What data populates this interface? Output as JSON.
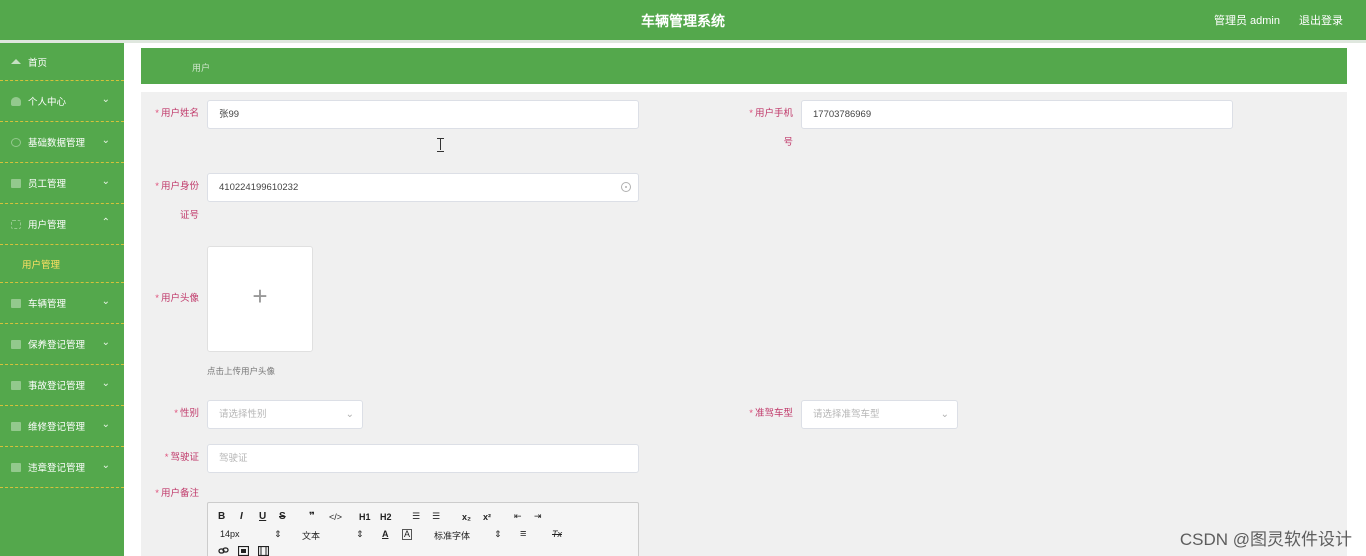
{
  "header": {
    "title": "车辆管理系统",
    "user_label": "管理员 admin",
    "logout_label": "退出登录"
  },
  "sidebar": {
    "items": [
      {
        "label": "首页",
        "icon": "home-icon"
      },
      {
        "label": "个人中心",
        "icon": "person-icon"
      },
      {
        "label": "基础数据管理",
        "icon": "gear-icon"
      },
      {
        "label": "员工管理",
        "icon": "user-icon"
      },
      {
        "label": "用户管理",
        "icon": "user-group-icon"
      },
      {
        "label": "车辆管理",
        "icon": "car-icon"
      },
      {
        "label": "保养登记管理",
        "icon": "document-icon"
      },
      {
        "label": "事故登记管理",
        "icon": "document-icon"
      },
      {
        "label": "维修登记管理",
        "icon": "document-icon"
      },
      {
        "label": "违章登记管理",
        "icon": "document-icon"
      }
    ],
    "submenu_label": "用户管理",
    "chevron_down": "⌄",
    "chevron_up": "⌃"
  },
  "breadcrumb": {
    "label": "用户"
  },
  "form": {
    "required_mark": "*",
    "name_label": "用户姓名",
    "name_value": "张99",
    "phone_label_line1": "用户手机",
    "phone_label_line2": "号",
    "phone_value": "17703786969",
    "id_label_line1": "用户身份",
    "id_label_line2": "证号",
    "id_value": "410224199610232",
    "avatar_label": "用户头像",
    "upload_plus": "+",
    "upload_hint": "点击上传用户头像",
    "gender_label": "性别",
    "gender_placeholder": "请选择性别",
    "license_type_label": "准驾车型",
    "license_type_placeholder": "请选择准驾车型",
    "license_label": "驾驶证",
    "license_placeholder": "驾驶证",
    "remark_label": "用户备注",
    "select_arrow": "⌄"
  },
  "editor": {
    "row1": [
      "B",
      "I",
      "U",
      "S",
      "❞",
      "</>",
      "H1",
      "H2",
      "☰",
      "☰",
      "x₂",
      "x²",
      "⇤",
      "⇥"
    ],
    "font_size": "14px",
    "text_format": "文本",
    "font_family": "标准字体",
    "updown": "⇕",
    "color": "A",
    "bg_color": "A",
    "align": "≡",
    "clear_format": "Tx"
  },
  "watermark": "CSDN @图灵软件设计"
}
